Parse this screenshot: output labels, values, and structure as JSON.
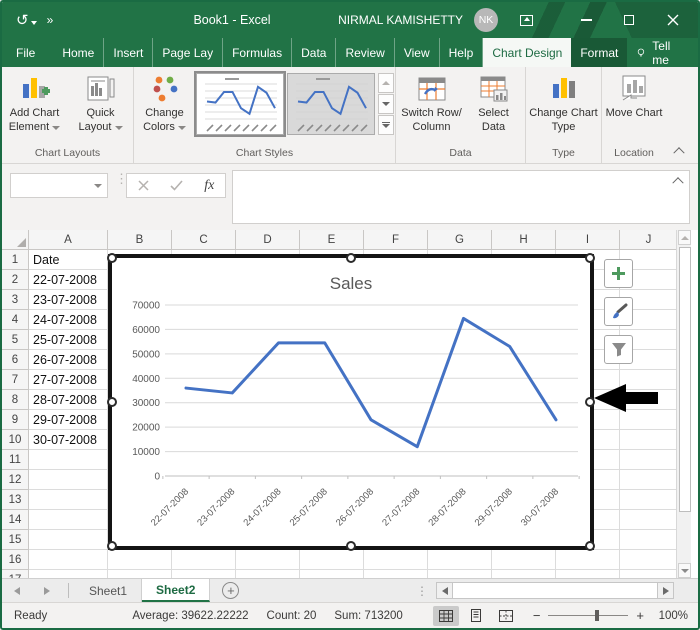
{
  "titlebar": {
    "title": "Book1 - Excel",
    "user": "NIRMAL KAMISHETTY",
    "avatar": "NK"
  },
  "tabbar": {
    "tabs": [
      {
        "label": "File",
        "active": false,
        "contextual": false
      },
      {
        "label": "Home",
        "active": false,
        "contextual": false
      },
      {
        "label": "Insert",
        "active": false,
        "contextual": false
      },
      {
        "label": "Page Lay",
        "active": false,
        "contextual": false
      },
      {
        "label": "Formulas",
        "active": false,
        "contextual": false
      },
      {
        "label": "Data",
        "active": false,
        "contextual": false
      },
      {
        "label": "Review",
        "active": false,
        "contextual": false
      },
      {
        "label": "View",
        "active": false,
        "contextual": false
      },
      {
        "label": "Help",
        "active": false,
        "contextual": false
      },
      {
        "label": "Chart Design",
        "active": true,
        "contextual": true
      },
      {
        "label": "Format",
        "active": false,
        "contextual": true
      }
    ],
    "tell_me": "Tell me"
  },
  "ribbon": {
    "chart_layouts": {
      "label": "Chart Layouts",
      "add_chart_element": "Add Chart Element",
      "quick_layout": "Quick Layout"
    },
    "chart_styles": {
      "label": "Chart Styles",
      "change_colors": "Change Colors"
    },
    "data": {
      "label": "Data",
      "switch_row_column": "Switch Row/ Column",
      "select_data": "Select Data"
    },
    "type": {
      "label": "Type",
      "change_chart_type": "Change Chart Type"
    },
    "location": {
      "label": "Location",
      "move_chart": "Move Chart"
    }
  },
  "formula_bar": {
    "name_box_value": "",
    "fx": "fx"
  },
  "grid": {
    "columns": [
      "A",
      "B",
      "C",
      "D",
      "E",
      "F",
      "G",
      "H",
      "I",
      "J"
    ],
    "row_count": 17,
    "a_values": [
      "Date",
      "22-07-2008",
      "23-07-2008",
      "24-07-2008",
      "25-07-2008",
      "26-07-2008",
      "27-07-2008",
      "28-07-2008",
      "29-07-2008",
      "30-07-2008"
    ]
  },
  "chart_data": {
    "type": "line",
    "title": "Sales",
    "categories": [
      "22-07-2008",
      "23-07-2008",
      "24-07-2008",
      "25-07-2008",
      "26-07-2008",
      "27-07-2008",
      "28-07-2008",
      "29-07-2008",
      "30-07-2008"
    ],
    "series": [
      {
        "name": "Sales",
        "values": [
          36000,
          34000,
          54500,
          54500,
          23000,
          12000,
          64500,
          53000,
          23000
        ]
      }
    ],
    "xlabel": "",
    "ylabel": "",
    "ylim": [
      0,
      70000
    ],
    "ytick_step": 10000,
    "grid": true,
    "legend": "none",
    "line_color": "#4472C4",
    "text_color": "#595959",
    "gridline_color": "#D9D9D9",
    "axis_color": "#BFBFBF"
  },
  "sheet_tabs": {
    "tabs": [
      {
        "label": "Sheet1",
        "active": false
      },
      {
        "label": "Sheet2",
        "active": true
      }
    ]
  },
  "status_bar": {
    "mode": "Ready",
    "average": "Average: 39622.22222",
    "count": "Count: 20",
    "sum": "Sum: 713200",
    "zoom": "100%"
  },
  "colors": {
    "excel_green": "#217346",
    "contextual_dark": "#1a5c38",
    "chart_line": "#4472C4"
  }
}
